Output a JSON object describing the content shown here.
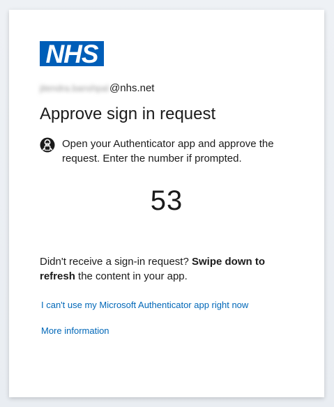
{
  "logo": {
    "text": "NHS",
    "color": "#005eb8"
  },
  "identity": {
    "username_obscured": "jitendra.banshpal",
    "domain": "@nhs.net"
  },
  "title": "Approve sign in request",
  "notice": {
    "icon": "authenticator-lock-icon",
    "text": "Open your Authenticator app and approve the request. Enter the number if prompted."
  },
  "number": "53",
  "help": {
    "prefix": "Didn't receive a sign-in request?",
    "bold1": "Swipe down to refresh",
    "suffix": "the content in your app."
  },
  "links": {
    "cant_use": "I can't use my Microsoft Authenticator app right now",
    "more_info": "More information"
  },
  "colors": {
    "link": "#0067b8",
    "text": "#1b1b1b",
    "nhs_blue": "#005eb8"
  }
}
